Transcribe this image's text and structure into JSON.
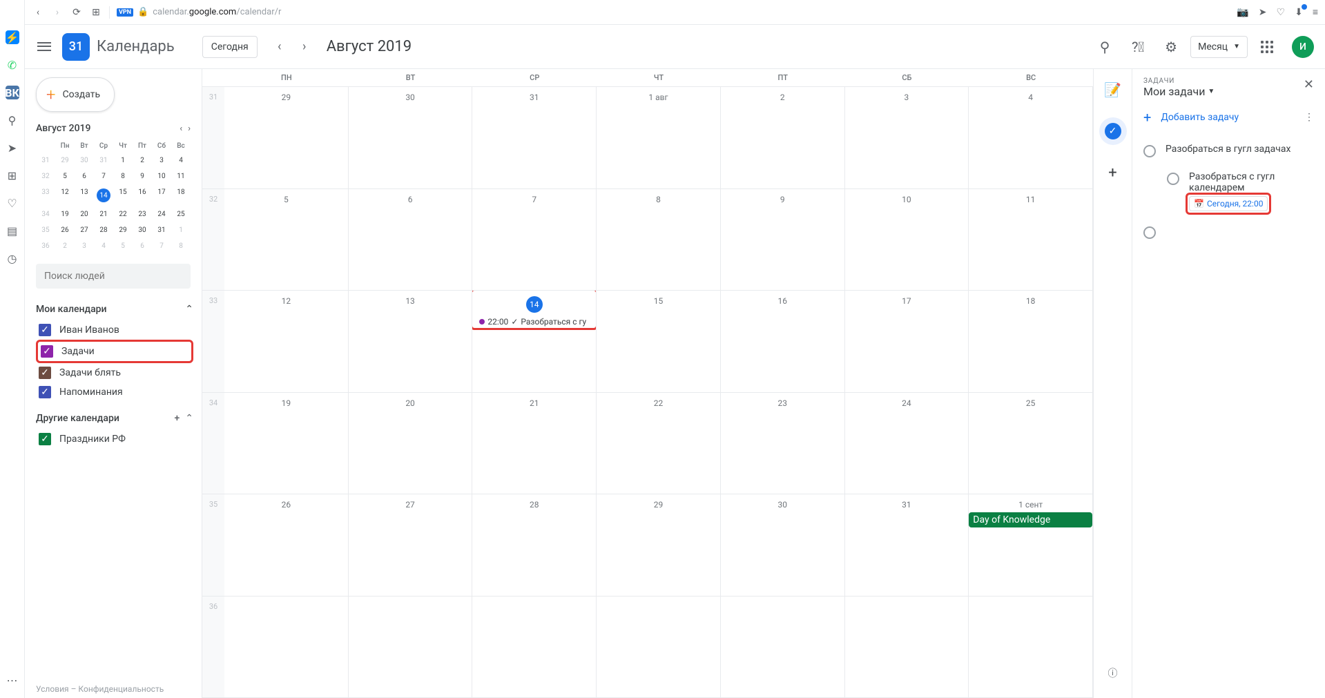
{
  "browser": {
    "url_host": "calendar.",
    "url_domain": "google.com",
    "url_path": "/calendar/r",
    "vpn": "VPN"
  },
  "header": {
    "logo_day": "31",
    "app_name": "Календарь",
    "today": "Сегодня",
    "period": "Август 2019",
    "view": "Месяц",
    "avatar": "И"
  },
  "sidebar": {
    "create": "Создать",
    "mini_title": "Август 2019",
    "mini_days": [
      "",
      "Пн",
      "Вт",
      "Ср",
      "Чт",
      "Пт",
      "Сб",
      "Вс"
    ],
    "mini_weeks": [
      {
        "wk": "31",
        "d": [
          "29",
          "30",
          "31",
          "1",
          "2",
          "3",
          "4"
        ],
        "dim": [
          0,
          1,
          2
        ]
      },
      {
        "wk": "32",
        "d": [
          "5",
          "6",
          "7",
          "8",
          "9",
          "10",
          "11"
        ]
      },
      {
        "wk": "33",
        "d": [
          "12",
          "13",
          "14",
          "15",
          "16",
          "17",
          "18"
        ],
        "today": 2
      },
      {
        "wk": "34",
        "d": [
          "19",
          "20",
          "21",
          "22",
          "23",
          "24",
          "25"
        ]
      },
      {
        "wk": "35",
        "d": [
          "26",
          "27",
          "28",
          "29",
          "30",
          "31",
          "1"
        ],
        "dim": [
          6
        ]
      },
      {
        "wk": "36",
        "d": [
          "2",
          "3",
          "4",
          "5",
          "6",
          "7",
          "8"
        ],
        "dim": [
          0,
          1,
          2,
          3,
          4,
          5,
          6
        ]
      }
    ],
    "search_placeholder": "Поиск людей",
    "my_cals": "Мои календари",
    "other_cals": "Другие календари",
    "cals": [
      {
        "label": "Иван Иванов",
        "color": "blue"
      },
      {
        "label": "Задачи",
        "color": "purple",
        "highlight": true
      },
      {
        "label": "Задачи блять",
        "color": "brown"
      },
      {
        "label": "Напоминания",
        "color": "blue"
      }
    ],
    "other": [
      {
        "label": "Праздники РФ",
        "color": "green"
      }
    ],
    "footer": "Условия – Конфиденциальность"
  },
  "calendar": {
    "day_headers": [
      "ПН",
      "ВТ",
      "СР",
      "ЧТ",
      "ПТ",
      "СБ",
      "ВС"
    ],
    "weeks": [
      {
        "num": "31",
        "days": [
          "29",
          "30",
          "31",
          "1 авг",
          "2",
          "3",
          "4"
        ]
      },
      {
        "num": "32",
        "days": [
          "5",
          "6",
          "7",
          "8",
          "9",
          "10",
          "11"
        ]
      },
      {
        "num": "33",
        "days": [
          "12",
          "13",
          "14",
          "15",
          "16",
          "17",
          "18"
        ],
        "today": 2,
        "event": {
          "col": 2,
          "time": "22:00",
          "text": "Разобраться с гу"
        }
      },
      {
        "num": "34",
        "days": [
          "19",
          "20",
          "21",
          "22",
          "23",
          "24",
          "25"
        ]
      },
      {
        "num": "35",
        "days": [
          "26",
          "27",
          "28",
          "29",
          "30",
          "31",
          "1 сент"
        ],
        "green": {
          "col": 6,
          "text": "Day of Knowledge"
        }
      },
      {
        "num": "36",
        "days": [
          "",
          "",
          "",
          "",
          "",
          "",
          ""
        ]
      }
    ]
  },
  "tasks": {
    "label": "ЗАДАЧИ",
    "list": "Мои задачи",
    "add": "Добавить задачу",
    "items": [
      {
        "text": "Разобраться в гугл задачах"
      },
      {
        "text": "Разобраться с гугл календарем",
        "sub": true,
        "chip": "Сегодня, 22:00",
        "chip_highlight": true
      }
    ]
  }
}
